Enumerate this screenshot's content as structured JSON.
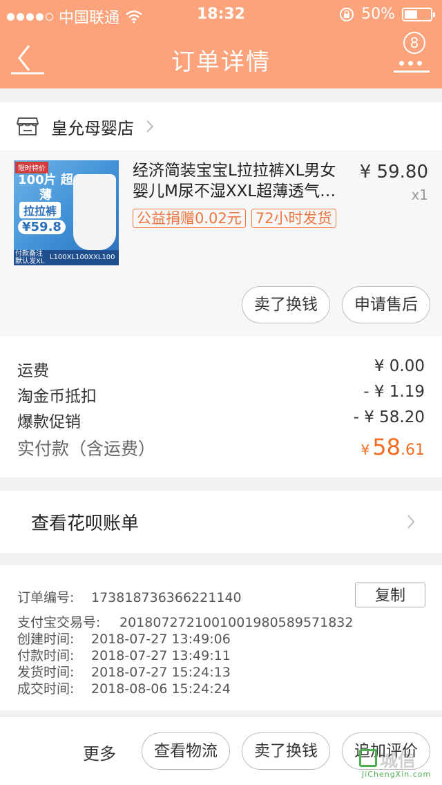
{
  "status_bar": {
    "carrier": "中国联通",
    "time": "18:32",
    "battery": "50%",
    "battery_level": 0.5,
    "signal_bars": 4
  },
  "nav": {
    "title": "订单详情",
    "badge_count": "8",
    "icons": [
      "back-arrow-icon",
      "more-icon"
    ]
  },
  "shop": {
    "name": "皇允母婴店"
  },
  "product": {
    "title": "经济简装宝宝L拉拉裤XL男女婴儿M尿不湿XXL超薄透气…",
    "price": "¥ 59.80",
    "qty": "x1",
    "tags": [
      "公益捐赠0.02元",
      "72小时发货"
    ],
    "thumb": {
      "badge": "限时特价",
      "headline": "100片 超薄",
      "pill": "拉拉裤",
      "price": "¥59.8",
      "foot_note": "付款备注 默认发XL",
      "sizes": "L100XL100XXL100"
    },
    "buttons": {
      "sell": "卖了换钱",
      "after_sale": "申请售后"
    }
  },
  "fees": {
    "shipping_label": "运费",
    "shipping_value": "¥ 0.00",
    "coin_label": "淘金币抵扣",
    "coin_value": "- ¥ 1.19",
    "promo_label": "爆款促销",
    "promo_value": "- ¥ 58.20",
    "total_label": "实付款（含运费）",
    "total_currency": "¥",
    "total_int": "58",
    "total_dec": ".61"
  },
  "huabei": {
    "label": "查看花呗账单"
  },
  "info": {
    "order_no_label": "订单编号:",
    "order_no": "173818736366221140",
    "copy_label": "复制",
    "alipay_label": "支付宝交易号:",
    "alipay_no": "2018072721001001980589571832",
    "created_label": "创建时间:",
    "created": "2018-07-27 13:49:06",
    "paid_label": "付款时间:",
    "paid": "2018-07-27 13:49:11",
    "shipped_label": "发货时间:",
    "shipped": "2018-07-27 15:24:13",
    "closed_label": "成交时间:",
    "closed": "2018-08-06 15:24:24"
  },
  "bottom": {
    "more": "更多",
    "logistics": "查看物流",
    "sell": "卖了换钱",
    "review": "追加评价"
  },
  "watermark": {
    "text": "城信",
    "url": "JiChengXin.com"
  },
  "colors": {
    "header": "#fca37b",
    "accent": "#f16d22",
    "tag": "#f0763f"
  }
}
